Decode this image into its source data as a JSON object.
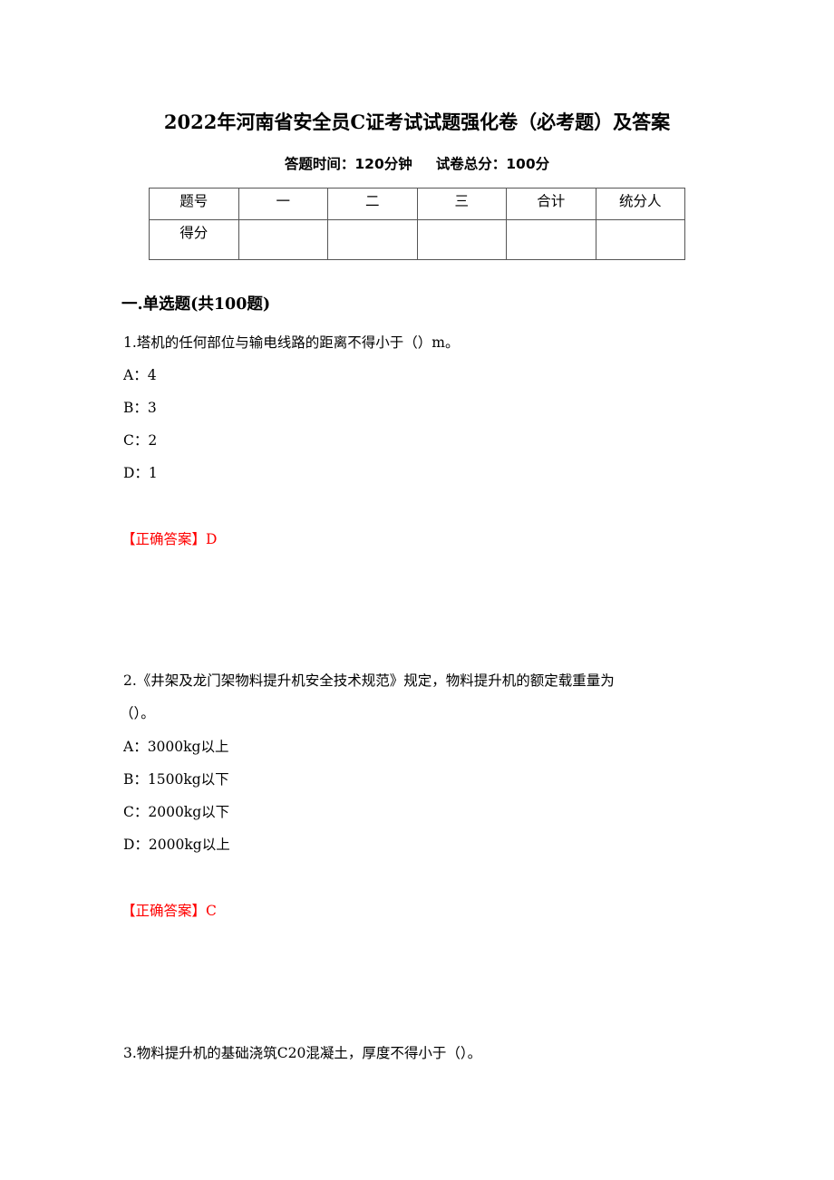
{
  "document": {
    "title": "2022年河南省安全员C证考试试题强化卷（必考题）及答案",
    "time_label": "答题时间：120分钟",
    "score_label": "试卷总分：100分"
  },
  "score_table": {
    "header": [
      "题号",
      "一",
      "二",
      "三",
      "合计",
      "统分人"
    ],
    "row2": [
      "得分",
      "",
      "",
      "",
      "",
      ""
    ]
  },
  "section": {
    "heading": "一.单选题(共100题)"
  },
  "questions": [
    {
      "stem": "1.塔机的任何部位与输电线路的距离不得小于（）m。",
      "options": [
        "A：4",
        "B：3",
        "C：2",
        "D：1"
      ],
      "answer": "【正确答案】D"
    },
    {
      "stem_line1": "2.《井架及龙门架物料提升机安全技术规范》规定，物料提升机的额定载重量为",
      "stem_line2": "（）。",
      "options": [
        "A：3000kg以上",
        "B：1500kg以下",
        "C：2000kg以下",
        "D：2000kg以上"
      ],
      "answer": "【正确答案】C"
    },
    {
      "stem": "3.物料提升机的基础浇筑C20混凝土，厚度不得小于（）。"
    }
  ],
  "colors": {
    "answer": "#ff0000",
    "text": "#000000"
  }
}
